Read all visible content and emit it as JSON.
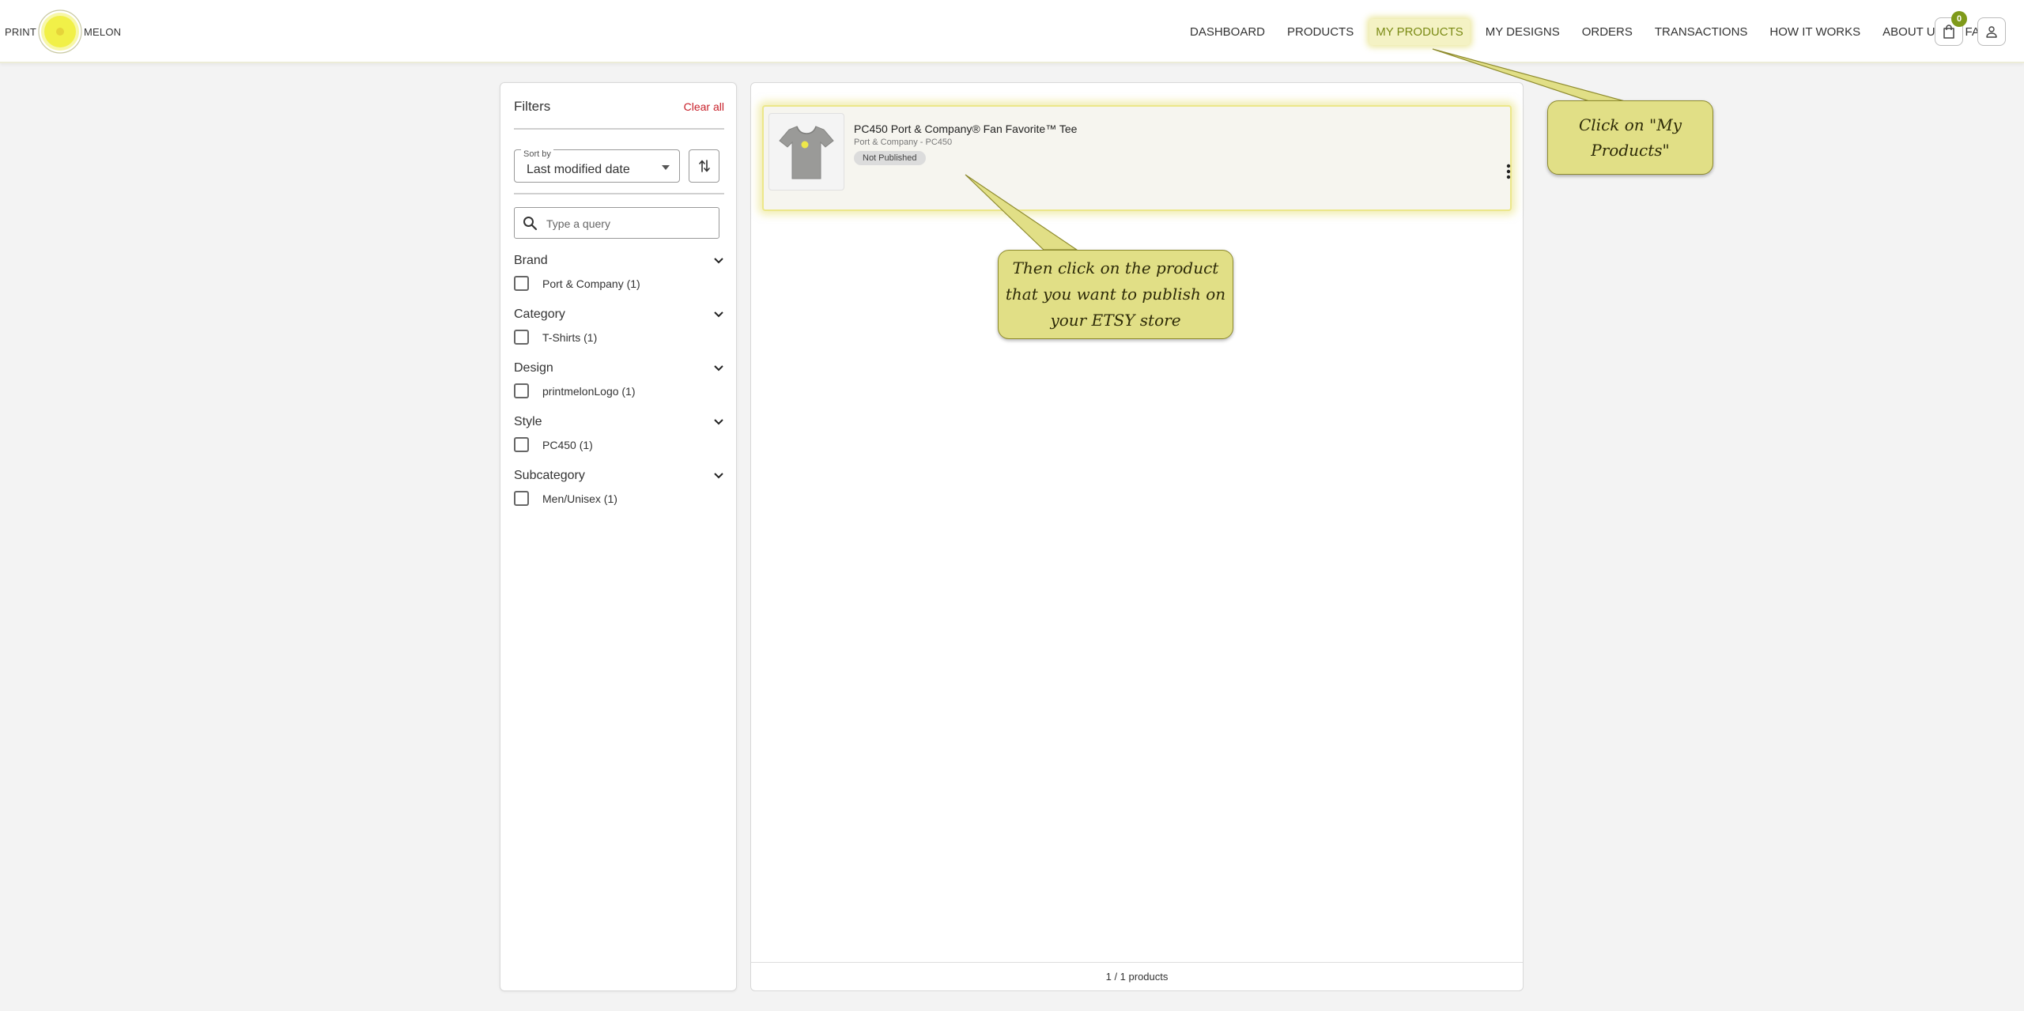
{
  "brand": {
    "left_text": "PRINT",
    "right_text": "MELON",
    "colors": {
      "accent": "#7f9a1a",
      "logo_fill": "#f0f04a",
      "highlight": "#f4f2c4",
      "callout": "#e1df86",
      "link_red": "#c8202a"
    }
  },
  "nav": {
    "items": [
      {
        "label": "DASHBOARD",
        "active": false
      },
      {
        "label": "PRODUCTS",
        "active": false
      },
      {
        "label": "MY PRODUCTS",
        "active": true
      },
      {
        "label": "MY DESIGNS",
        "active": false
      },
      {
        "label": "ORDERS",
        "active": false
      },
      {
        "label": "TRANSACTIONS",
        "active": false
      },
      {
        "label": "HOW IT WORKS",
        "active": false
      },
      {
        "label": "ABOUT US",
        "active": false
      },
      {
        "label": "FAQ",
        "active": false
      }
    ],
    "cart": {
      "icon": "shopping-bag-icon",
      "count": "0"
    },
    "user": {
      "icon": "user-icon"
    }
  },
  "filters": {
    "title": "Filters",
    "clear_all": "Clear all",
    "sort": {
      "label": "Sort by",
      "value": "Last modified date"
    },
    "search": {
      "placeholder": "Type a query",
      "value": ""
    },
    "groups": [
      {
        "title": "Brand",
        "options": [
          {
            "label": "Port & Company (1)",
            "checked": false
          }
        ]
      },
      {
        "title": "Category",
        "options": [
          {
            "label": "T-Shirts (1)",
            "checked": false
          }
        ]
      },
      {
        "title": "Design",
        "options": [
          {
            "label": "printmelonLogo (1)",
            "checked": false
          }
        ]
      },
      {
        "title": "Style",
        "options": [
          {
            "label": "PC450 (1)",
            "checked": false
          }
        ]
      },
      {
        "title": "Subcategory",
        "options": [
          {
            "label": "Men/Unisex (1)",
            "checked": false
          }
        ]
      }
    ]
  },
  "products": {
    "items": [
      {
        "title": "PC450 Port & Company® Fan Favorite™ Tee",
        "subtitle": "Port & Company - PC450",
        "status": "Not Published"
      }
    ],
    "footer": "1 / 1 products"
  },
  "callouts": {
    "first": "Click on \"My Products\"",
    "second": "Then click on the product that you want to publish on your ETSY store"
  }
}
